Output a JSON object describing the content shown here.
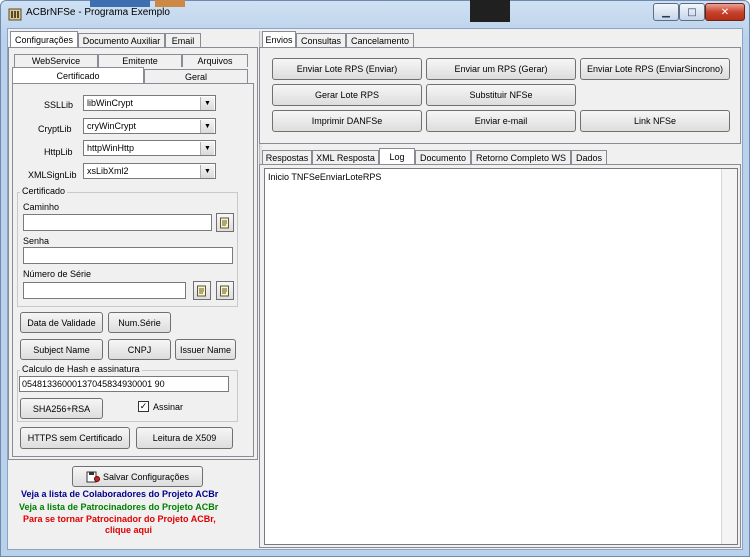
{
  "window": {
    "title": "ACBrNFSe - Programa Exemplo",
    "minimize_glyph": "▁",
    "maximize_glyph": "□",
    "close_glyph": "✕"
  },
  "left": {
    "tabs_row1": [
      "Configurações",
      "Documento Auxiliar",
      "Email"
    ],
    "tabs_row2": [
      "WebService",
      "Emitente",
      "Arquivos"
    ],
    "tabs_row3": [
      "Certificado",
      "Geral"
    ],
    "combos": [
      {
        "label": "SSLLib",
        "value": "libWinCrypt"
      },
      {
        "label": "CryptLib",
        "value": "cryWinCrypt"
      },
      {
        "label": "HttpLib",
        "value": "httpWinHttp"
      },
      {
        "label": "XMLSignLib",
        "value": "xsLibXml2"
      }
    ],
    "cert_group": "Certificado",
    "caminho_label": "Caminho",
    "caminho_value": "",
    "senha_label": "Senha",
    "senha_value": "",
    "serie_label": "Número de Série",
    "serie_value": "",
    "btn_data_validade": "Data de Validade",
    "btn_num_serie": "Num.Série",
    "btn_subject": "Subject Name",
    "btn_cnpj": "CNPJ",
    "btn_issuer": "Issuer Name",
    "hash_group": "Calculo de Hash e assinatura",
    "hash_value": "05481336000137045834930001 90",
    "btn_sha": "SHA256+RSA",
    "assinar_label": "Assinar",
    "assinar_checked": true,
    "btn_https": "HTTPS sem Certificado",
    "btn_x509": "Leitura de X509",
    "btn_salvar": "Salvar Configurações",
    "link_colaboradores": "Veja a lista de Colaboradores do Projeto ACBr",
    "link_patrocinadores": "Veja a lista de Patrocinadores do Projeto ACBr",
    "link_patrocinar_1": "Para se tornar Patrocinador do Projeto ACBr,",
    "link_patrocinar_2": "clique aqui",
    "color_colab": "#00008b",
    "color_patroc": "#008000",
    "color_patrocinar": "#e00000"
  },
  "right": {
    "tabs_top": [
      "Envios",
      "Consultas",
      "Cancelamento"
    ],
    "buttons": [
      "Enviar Lote RPS (Enviar)",
      "Enviar um RPS (Gerar)",
      "Enviar Lote RPS (EnviarSincrono)",
      "Gerar Lote RPS",
      "Substituir NFSe",
      "Imprimir DANFSe",
      "Enviar e-mail",
      "Link NFSe"
    ],
    "tabs_bottom": [
      "Respostas",
      "XML Resposta",
      "Log",
      "Documento",
      "Retorno Completo WS",
      "Dados"
    ],
    "log_text": "Inicio TNFSeEnviarLoteRPS"
  }
}
